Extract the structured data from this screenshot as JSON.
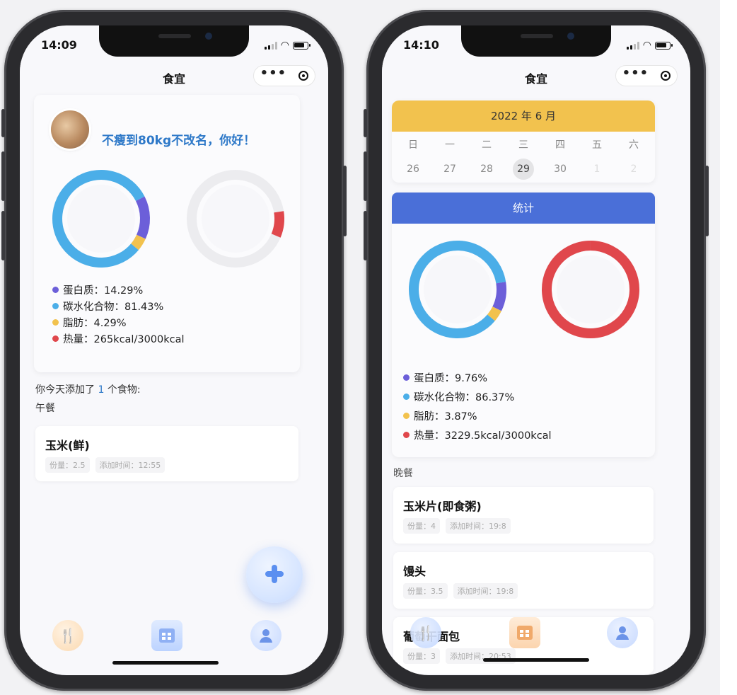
{
  "left": {
    "status": {
      "time": "14:09"
    },
    "nav": {
      "title": "食宜"
    },
    "greeting": "不瘦到80kg不改名，你好！",
    "stats": {
      "protein": "蛋白质：14.29%",
      "carbs": "碳水化合物：81.43%",
      "fat": "脂肪：4.29%",
      "energy": "热量：265kcal/3000kcal"
    },
    "rings": {
      "macros": [
        {
          "name": "carbs",
          "fraction": 0.8143,
          "color": "#4baee8"
        },
        {
          "name": "protein",
          "fraction": 0.1429,
          "color": "#6c5fd9"
        },
        {
          "name": "fat",
          "fraction": 0.0429,
          "color": "#f2c24e"
        }
      ],
      "energy_fraction": 0.0883
    },
    "added_prefix": "你今天添加了",
    "added_count": "1",
    "added_suffix": "个食物:",
    "meal": "午餐",
    "foods": [
      {
        "name": "玉米(鲜)",
        "portion": "份量：2.5",
        "time": "添加时间：12:55"
      }
    ]
  },
  "right": {
    "status": {
      "time": "14:10"
    },
    "nav": {
      "title": "食宜"
    },
    "calendar": {
      "title": "2022 年 6 月",
      "weekdays": [
        "日",
        "一",
        "二",
        "三",
        "四",
        "五",
        "六"
      ],
      "days": [
        "26",
        "27",
        "28",
        "29",
        "30",
        "1",
        "2"
      ],
      "selected": "29"
    },
    "stats_header": "统计",
    "stats": {
      "protein": "蛋白质：9.76%",
      "carbs": "碳水化合物：86.37%",
      "fat": "脂肪：3.87%",
      "energy": "热量：3229.5kcal/3000kcal"
    },
    "rings": {
      "macros": [
        {
          "name": "carbs",
          "fraction": 0.8637,
          "color": "#4baee8"
        },
        {
          "name": "protein",
          "fraction": 0.0976,
          "color": "#6c5fd9"
        },
        {
          "name": "fat",
          "fraction": 0.0387,
          "color": "#f2c24e"
        }
      ],
      "energy_fraction": 1.0
    },
    "meal": "晚餐",
    "foods": [
      {
        "name": "玉米片(即食粥)",
        "portion": "份量：4",
        "time": "添加时间：19:8"
      },
      {
        "name": "馒头",
        "portion": "份量：3.5",
        "time": "添加时间：19:8"
      },
      {
        "name": "葡萄干面包",
        "portion": "份量：3",
        "time": "添加时间：20:53"
      }
    ]
  },
  "colors": {
    "protein": "#6c5fd9",
    "carbs": "#4baee8",
    "fat": "#f2c24e",
    "energy": "#e0474c",
    "ring_bg": "#ececef",
    "accent": "#2d78c8",
    "calendar_header": "#f2c24e",
    "stats_header": "#4a6fd8"
  },
  "icons": {
    "fab": "plus-icon",
    "tab1": "fork-knife-icon",
    "tab2": "calendar-grid-icon",
    "tab3": "user-icon"
  }
}
